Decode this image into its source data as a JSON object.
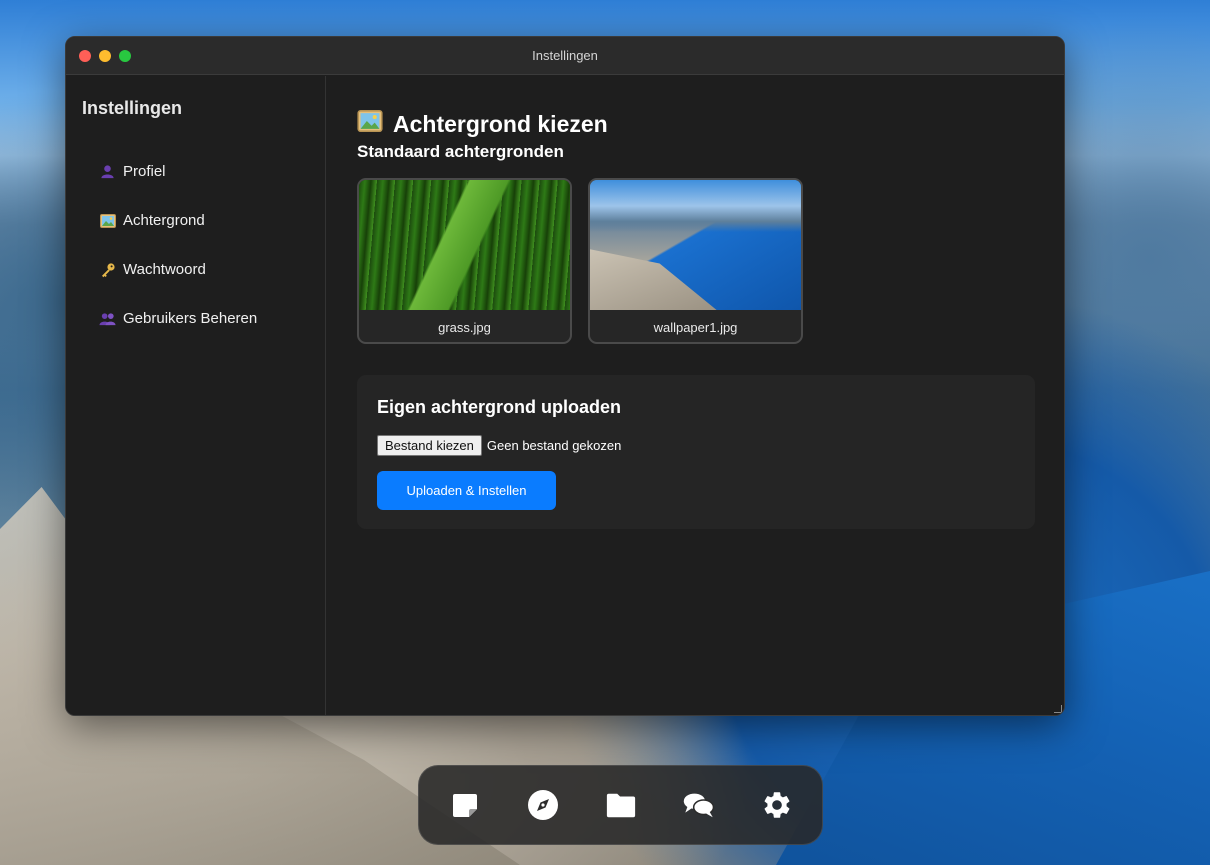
{
  "window": {
    "title": "Instellingen"
  },
  "sidebar": {
    "heading": "Instellingen",
    "items": [
      {
        "label": "Profiel",
        "icon": "user-icon"
      },
      {
        "label": "Achtergrond",
        "icon": "picture-icon"
      },
      {
        "label": "Wachtwoord",
        "icon": "key-icon"
      },
      {
        "label": "Gebruikers Beheren",
        "icon": "users-icon"
      }
    ]
  },
  "main": {
    "title": "Achtergrond kiezen",
    "title_icon": "picture-icon",
    "section_title": "Standaard achtergronden",
    "wallpapers": [
      {
        "name": "grass.jpg"
      },
      {
        "name": "wallpaper1.jpg"
      }
    ],
    "upload": {
      "title": "Eigen achtergrond uploaden",
      "file_button": "Bestand kiezen",
      "file_status": "Geen bestand gekozen",
      "submit_label": "Uploaden & Instellen"
    }
  },
  "dock": {
    "items": [
      "notes-icon",
      "compass-icon",
      "folder-icon",
      "chat-icon",
      "settings-icon"
    ]
  },
  "colors": {
    "accent": "#0a7cff",
    "window_bg": "#1e1e1e",
    "titlebar_bg": "#2b2b2b",
    "close": "#ff5f57",
    "minimize": "#febc2e",
    "maximize": "#28c840"
  }
}
